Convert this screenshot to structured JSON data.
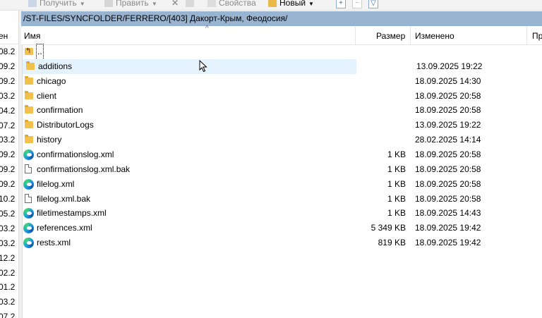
{
  "toolbar": {
    "get_label": "Получить",
    "edit_label": "Править",
    "properties_label": "Свойства",
    "new_label": "Новый",
    "icons": [
      "download-icon",
      "edit-icon",
      "delete-icon",
      "rename-icon",
      "properties-icon",
      "new-folder-icon",
      "add-icon",
      "remove-icon",
      "filter-icon"
    ]
  },
  "left_pane": {
    "header": "ен",
    "dates": [
      "08.2",
      "09.2",
      "09.2",
      "03.2",
      "04.2",
      "07.2",
      "03.2",
      "09.2",
      "09.2",
      "09.2",
      "10.2",
      "05.2",
      "03.2",
      "03.2",
      "12.2",
      "02.2",
      "01.2",
      "03.2",
      "07.2"
    ]
  },
  "path": "/ST-FILES/SYNCFOLDER/FERRERO/[403] Дакорт-Крым, Феодосия/",
  "columns": {
    "name": "Имя",
    "size": "Размер",
    "modified": "Изменено",
    "rights": "Пр"
  },
  "files": [
    {
      "name": "..",
      "icon": "parent-dir-icon",
      "size": "",
      "modified": ""
    },
    {
      "name": "additions",
      "icon": "folder-icon",
      "size": "",
      "modified": "13.09.2025 19:22"
    },
    {
      "name": "chicago",
      "icon": "folder-icon",
      "size": "",
      "modified": "18.09.2025 14:30"
    },
    {
      "name": "client",
      "icon": "folder-icon",
      "size": "",
      "modified": "18.09.2025 20:58"
    },
    {
      "name": "confirmation",
      "icon": "folder-icon",
      "size": "",
      "modified": "18.09.2025 20:58"
    },
    {
      "name": "DistributorLogs",
      "icon": "folder-icon",
      "size": "",
      "modified": "13.09.2025 19:22"
    },
    {
      "name": "history",
      "icon": "folder-icon",
      "size": "",
      "modified": "28.02.2025 14:14"
    },
    {
      "name": "confirmationslog.xml",
      "icon": "edge-icon",
      "size": "1 KB",
      "modified": "18.09.2025 20:58"
    },
    {
      "name": "confirmationslog.xml.bak",
      "icon": "file-icon",
      "size": "1 KB",
      "modified": "18.09.2025 20:58"
    },
    {
      "name": "filelog.xml",
      "icon": "edge-icon",
      "size": "1 KB",
      "modified": "18.09.2025 20:58"
    },
    {
      "name": "filelog.xml.bak",
      "icon": "file-icon",
      "size": "1 KB",
      "modified": "18.09.2025 20:58"
    },
    {
      "name": "filetimestamps.xml",
      "icon": "edge-icon",
      "size": "1 KB",
      "modified": "18.09.2025 14:43"
    },
    {
      "name": "references.xml",
      "icon": "edge-icon",
      "size": "5 349 KB",
      "modified": "18.09.2025 19:42"
    },
    {
      "name": "rests.xml",
      "icon": "edge-icon",
      "size": "819 KB",
      "modified": "18.09.2025 19:42"
    }
  ],
  "colors": {
    "path_bar": "#99b4d1",
    "hover_row": "#e5f3ff",
    "folder": "#f2c04c"
  }
}
